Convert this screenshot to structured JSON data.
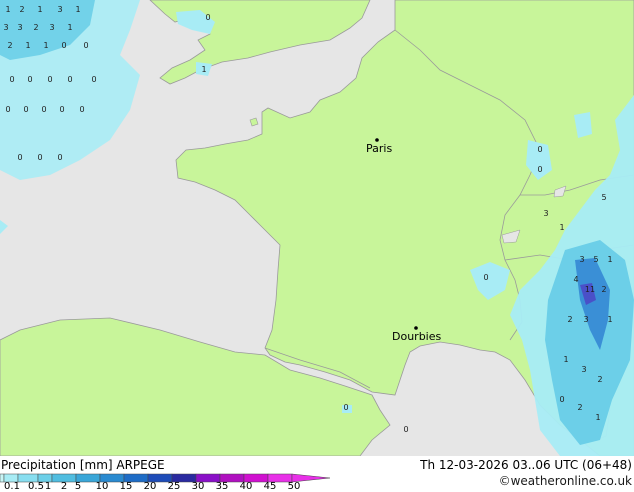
{
  "map": {
    "cities": [
      {
        "name": "Paris"
      },
      {
        "name": "Dourbies"
      }
    ],
    "colors": {
      "sea": "#e6e6e6",
      "land": "#c8f59a",
      "border": "#9a9a9a",
      "precip_light": "#a8ecf5",
      "precip_mid": "#6ccfe8",
      "precip_heavy": "#3a8fd6",
      "precip_very_heavy": "#4a50c8"
    }
  },
  "footer": {
    "title_left": "Precipitation [mm] ARPEGE",
    "title_right": "Th 12-03-2026 03..06 UTC (06+48)",
    "credit": "©weatheronline.co.uk",
    "legend_ticks": [
      "0.1",
      "0.5",
      "1",
      "2",
      "5",
      "10",
      "15",
      "20",
      "25",
      "30",
      "35",
      "40",
      "45",
      "50"
    ],
    "legend_colors": [
      "#c8f5f5",
      "#a8ecf5",
      "#88def0",
      "#6ccfe8",
      "#50bde0",
      "#3aa6d8",
      "#2a8ad0",
      "#1e6cc6",
      "#1e4cb8",
      "#2a2aa0",
      "#8a10c8",
      "#b010c0",
      "#d010d0",
      "#e830e8"
    ]
  }
}
